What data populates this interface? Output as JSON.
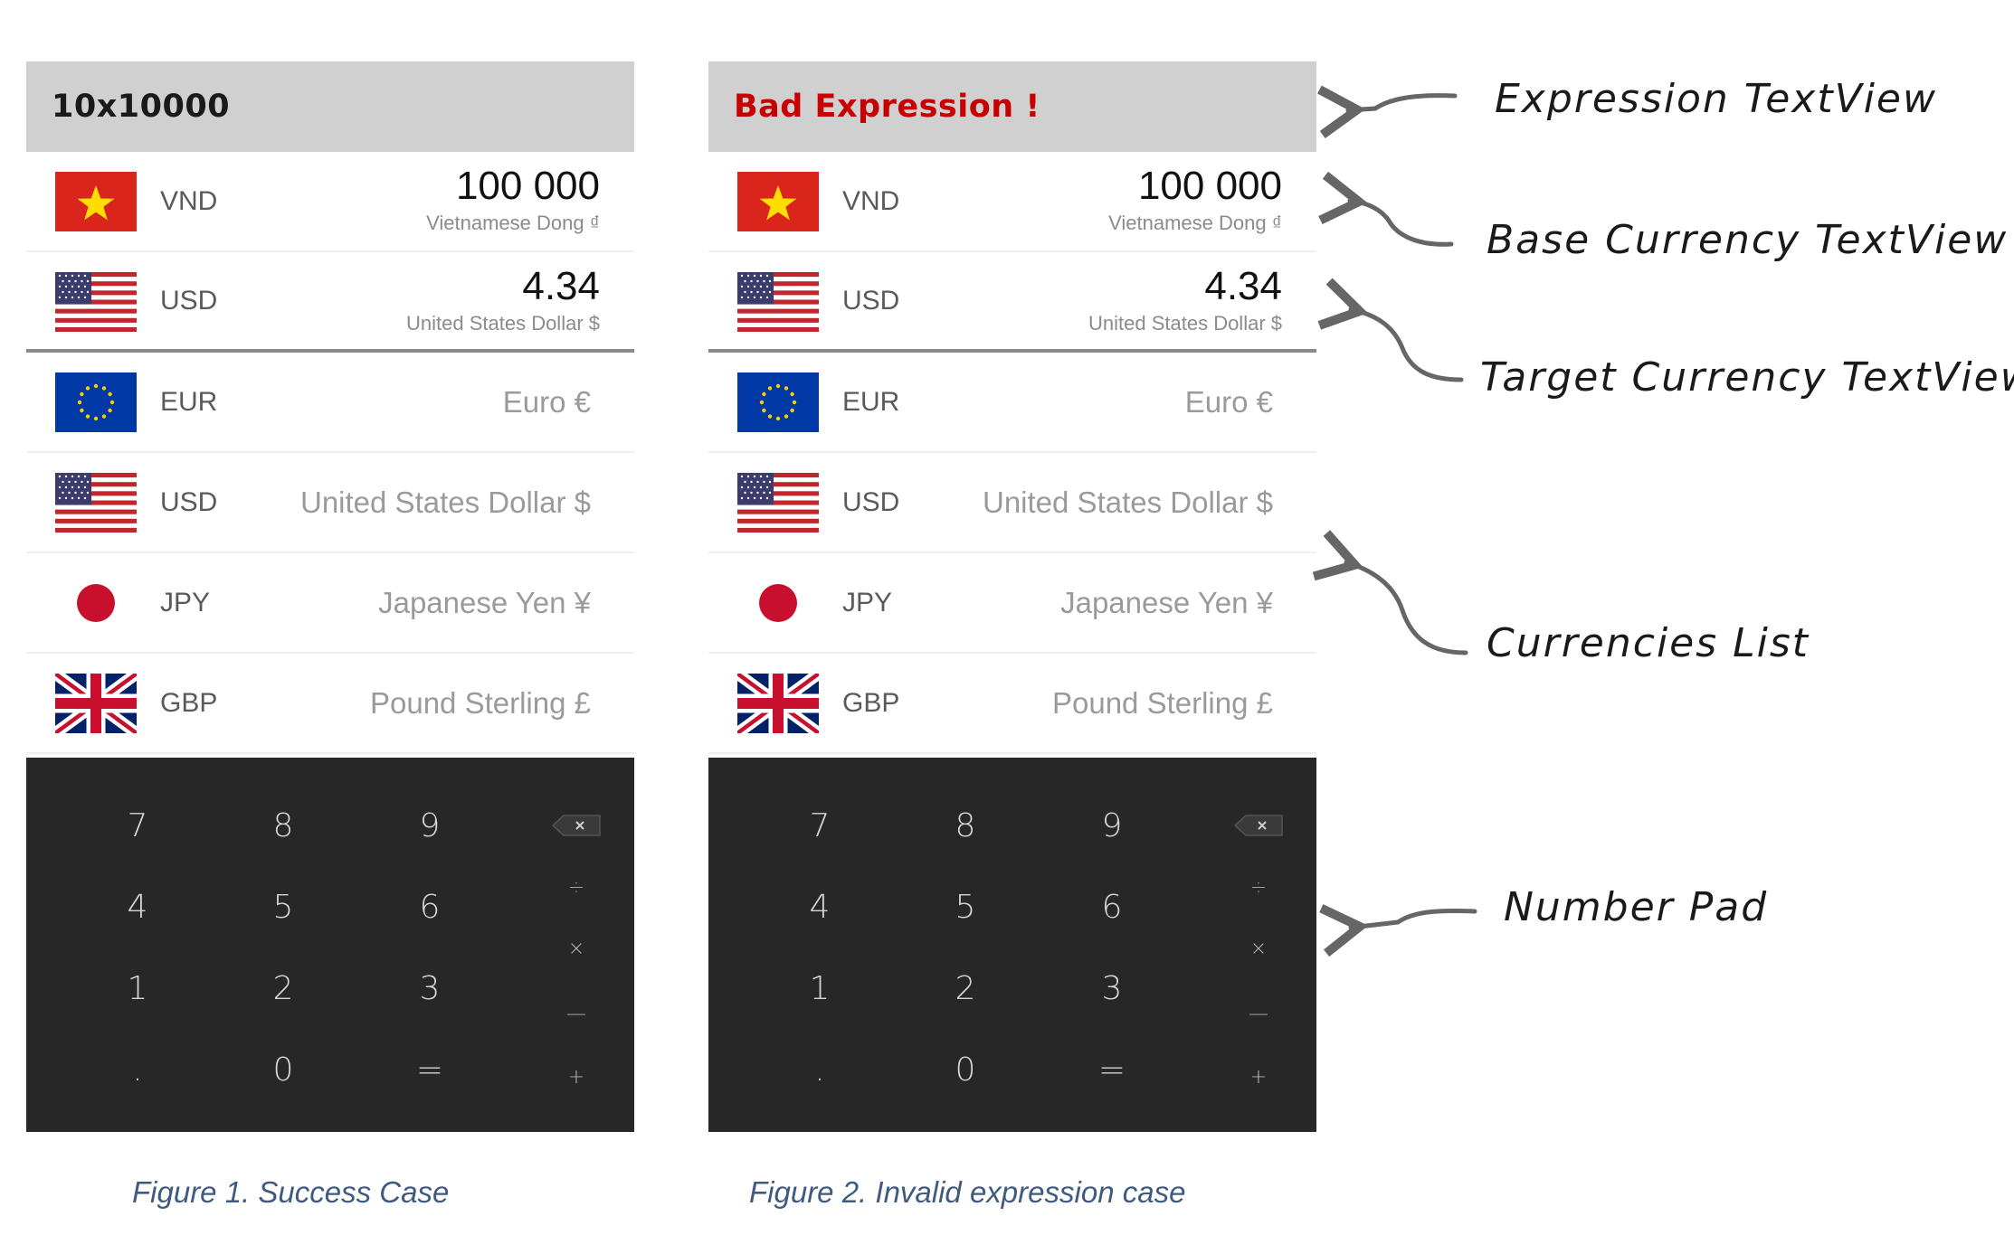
{
  "phones": [
    {
      "expression": "10x10000",
      "base": {
        "flag": "vietnam-flag",
        "code": "VND",
        "value": "100 000",
        "name": "Vietnamese Dong ₫"
      },
      "target": {
        "flag": "us-flag",
        "code": "USD",
        "value": "4.34",
        "name": "United States Dollar $"
      },
      "list": [
        {
          "flag": "eu-flag",
          "code": "EUR",
          "name": "Euro €"
        },
        {
          "flag": "us-flag",
          "code": "USD",
          "name": "United States Dollar $"
        },
        {
          "flag": "japan-flag",
          "code": "JPY",
          "name": "Japanese Yen ¥"
        },
        {
          "flag": "uk-flag",
          "code": "GBP",
          "name": "Pound Sterling £"
        }
      ],
      "caption": "Figure 1. Success Case"
    },
    {
      "expression": "Bad Expression !",
      "base": {
        "flag": "vietnam-flag",
        "code": "VND",
        "value": "100 000",
        "name": "Vietnamese Dong ₫"
      },
      "target": {
        "flag": "us-flag",
        "code": "USD",
        "value": "4.34",
        "name": "United States Dollar $"
      },
      "list": [
        {
          "flag": "eu-flag",
          "code": "EUR",
          "name": "Euro €"
        },
        {
          "flag": "us-flag",
          "code": "USD",
          "name": "United States Dollar $"
        },
        {
          "flag": "japan-flag",
          "code": "JPY",
          "name": "Japanese Yen ¥"
        },
        {
          "flag": "uk-flag",
          "code": "GBP",
          "name": "Pound Sterling £"
        }
      ],
      "caption": "Figure 2. Invalid expression case"
    }
  ],
  "keypad": {
    "digits": [
      "7",
      "8",
      "9",
      "4",
      "5",
      "6",
      "1",
      "2",
      "3",
      ".",
      "0",
      "="
    ],
    "operators": [
      "backspace-icon",
      "÷",
      "×",
      "—",
      "+"
    ]
  },
  "annotations": {
    "expression": "Expression TextView",
    "base": "Base Currency TextView",
    "target": "Target Currency TextView",
    "list": "Currencies List",
    "pad": "Number Pad"
  },
  "colors": {
    "expression_bar": "#d0d0d0",
    "error_text": "#c70000",
    "keypad_bg": "#272727",
    "caption": "#3f5a80"
  }
}
